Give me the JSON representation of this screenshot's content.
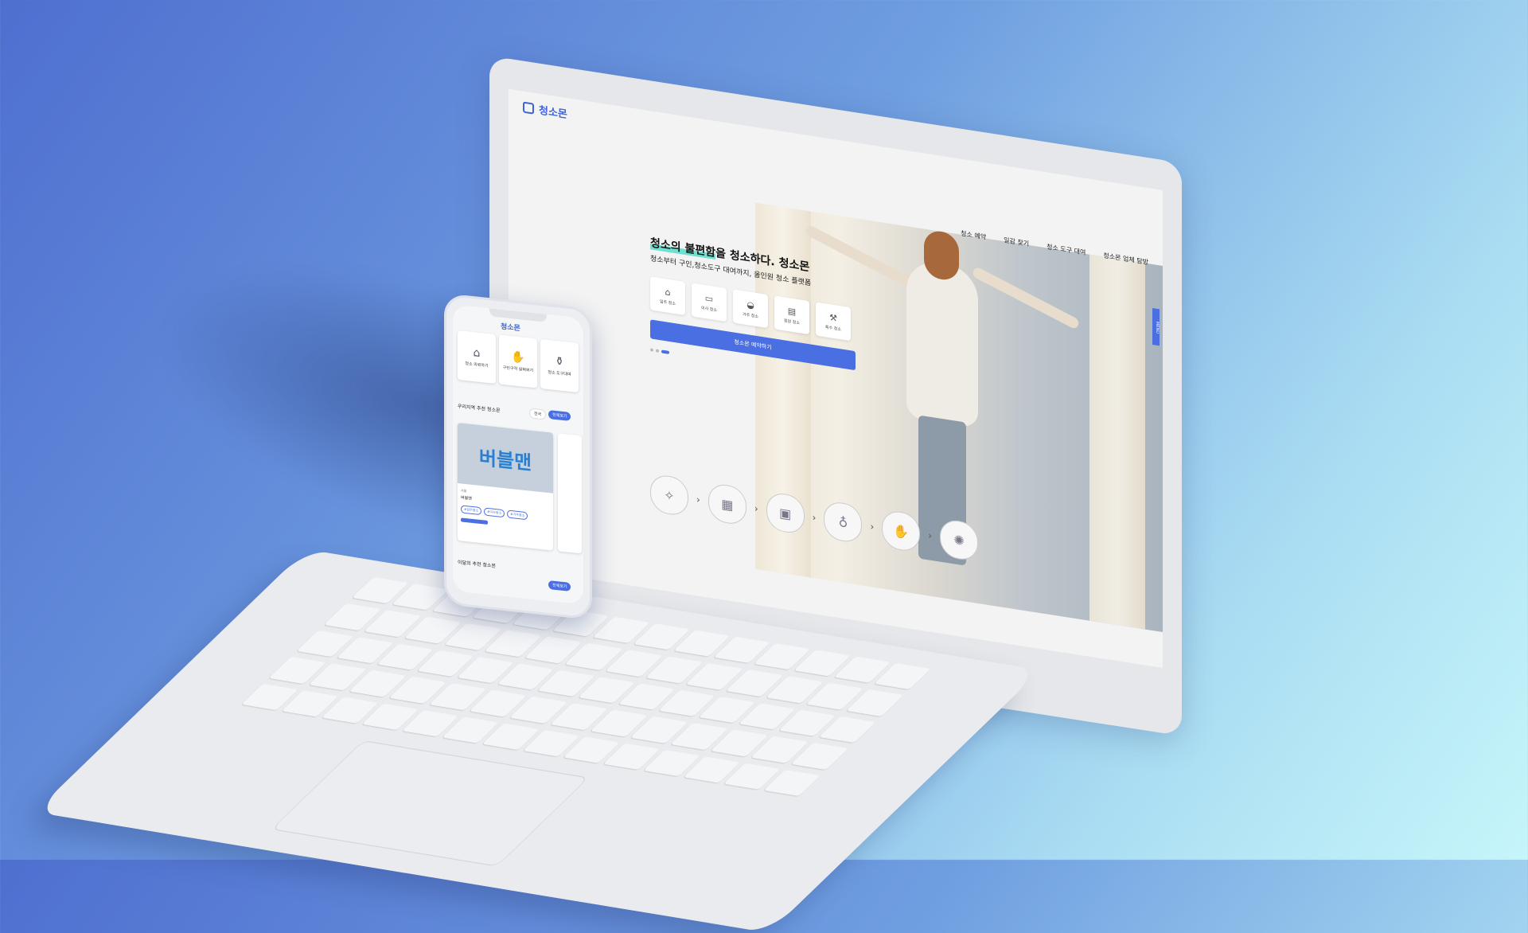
{
  "laptop": {
    "logo": "청소몬",
    "nav": [
      "청소 예약",
      "일감 찾기",
      "청소 도구 대여",
      "청소몬 업체 탐방"
    ],
    "menu_tab": "MENU",
    "hero": {
      "title_highlight": "청소의 불편함",
      "title_rest": "을 청소하다. 청소몬",
      "subtitle": "청소부터 구인,청소도구 대여까지, 올인원 청소 플랫폼"
    },
    "categories": [
      {
        "label": "입주 청소",
        "icon": "house-icon"
      },
      {
        "label": "이사 청소",
        "icon": "truck-icon"
      },
      {
        "label": "거주 청소",
        "icon": "sofa-icon"
      },
      {
        "label": "정원 청소",
        "icon": "bag-icon"
      },
      {
        "label": "특수 청소",
        "icon": "tools-icon"
      }
    ],
    "book_button": "청소몬 예약하기",
    "process_icons": [
      "cleaning-icon",
      "board-icon",
      "calendar-icon",
      "people-icon",
      "hand-icon",
      "sparkle-icon"
    ]
  },
  "phone": {
    "logo": "청소몬",
    "categories": [
      {
        "label": "청소\n의뢰하기",
        "icon": "house-icon"
      },
      {
        "label": "구인구직\n살펴보기",
        "icon": "hand-icon"
      },
      {
        "label": "청소\n도구대여",
        "icon": "spray-icon"
      }
    ],
    "section1_title": "우리지역 추천 청소몬",
    "chip_region": "전국",
    "chip_more": "전체보기",
    "card": {
      "image_text": "버블맨",
      "category": "서울",
      "name": "버블맨",
      "tags": [
        "#입주청소",
        "#이사청소",
        "#거주청소"
      ]
    },
    "section2_title": "이달의 추천 청소몬",
    "chip_more2": "전체보기"
  },
  "colors": {
    "accent": "#4a6fe3",
    "highlight": "#6fe0d0",
    "background_start": "#4f6fd0",
    "background_end": "#c6f6fa"
  }
}
